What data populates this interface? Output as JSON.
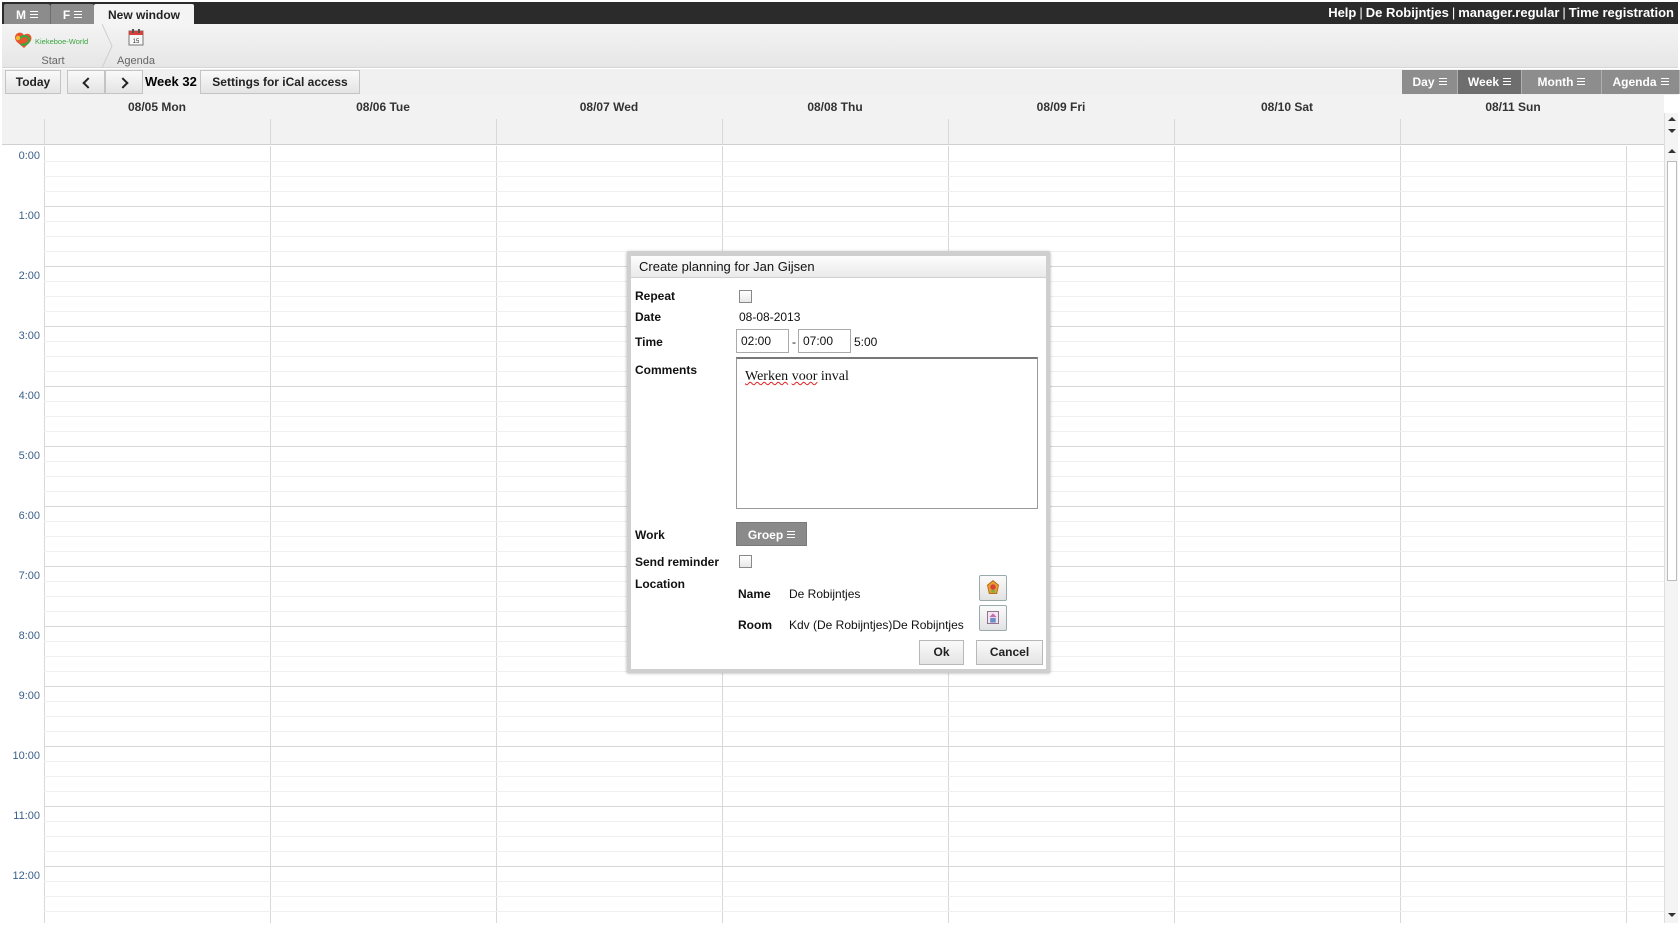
{
  "topbar": {
    "tabs": [
      {
        "label": "M"
      },
      {
        "label": "F"
      },
      {
        "label": "New window"
      }
    ],
    "links": [
      "Help",
      "De Robijntjes",
      "manager.regular",
      "Time registration"
    ],
    "separator": "|"
  },
  "launcher": {
    "start_label": "Start",
    "logo_text": "Kiekeboe-World",
    "agenda_label": "Agenda",
    "agenda_icon_day": "15"
  },
  "toolbar": {
    "today_label": "Today",
    "week_label": "Week 32",
    "ical_label": "Settings for iCal access",
    "views": [
      {
        "label": "Day"
      },
      {
        "label": "Week"
      },
      {
        "label": "Month"
      },
      {
        "label": "Agenda"
      }
    ],
    "selected_view": "Week"
  },
  "calendar": {
    "days": [
      "08/05 Mon",
      "08/06 Tue",
      "08/07 Wed",
      "08/08 Thu",
      "08/09 Fri",
      "08/10 Sat",
      "08/11 Sun"
    ],
    "hours": [
      "0:00",
      "1:00",
      "2:00",
      "3:00",
      "4:00",
      "5:00",
      "6:00",
      "7:00",
      "8:00",
      "9:00",
      "10:00",
      "11:00",
      "12:00"
    ]
  },
  "dialog": {
    "title": "Create planning for Jan Gijsen",
    "repeat_label": "Repeat",
    "date_label": "Date",
    "date_value": "08-08-2013",
    "time_label": "Time",
    "time_from": "02:00",
    "time_separator": "-",
    "time_to": "07:00",
    "duration": "5:00",
    "comments_label": "Comments",
    "comments_words": [
      "Werken",
      "voor",
      "inval"
    ],
    "work_label": "Work",
    "work_value": "Groep",
    "reminder_label": "Send reminder",
    "location_label": "Location",
    "name_label": "Name",
    "name_value": "De Robijntjes",
    "room_label": "Room",
    "room_value": "Kdv (De Robijntjes)De Robijntjes",
    "ok_label": "Ok",
    "cancel_label": "Cancel"
  },
  "colors": {
    "topbar_bg": "#2b2b2b",
    "view_button": "#8d8d8d",
    "time_label": "#3b5f8a",
    "grid_line": "#d8d8d8"
  }
}
